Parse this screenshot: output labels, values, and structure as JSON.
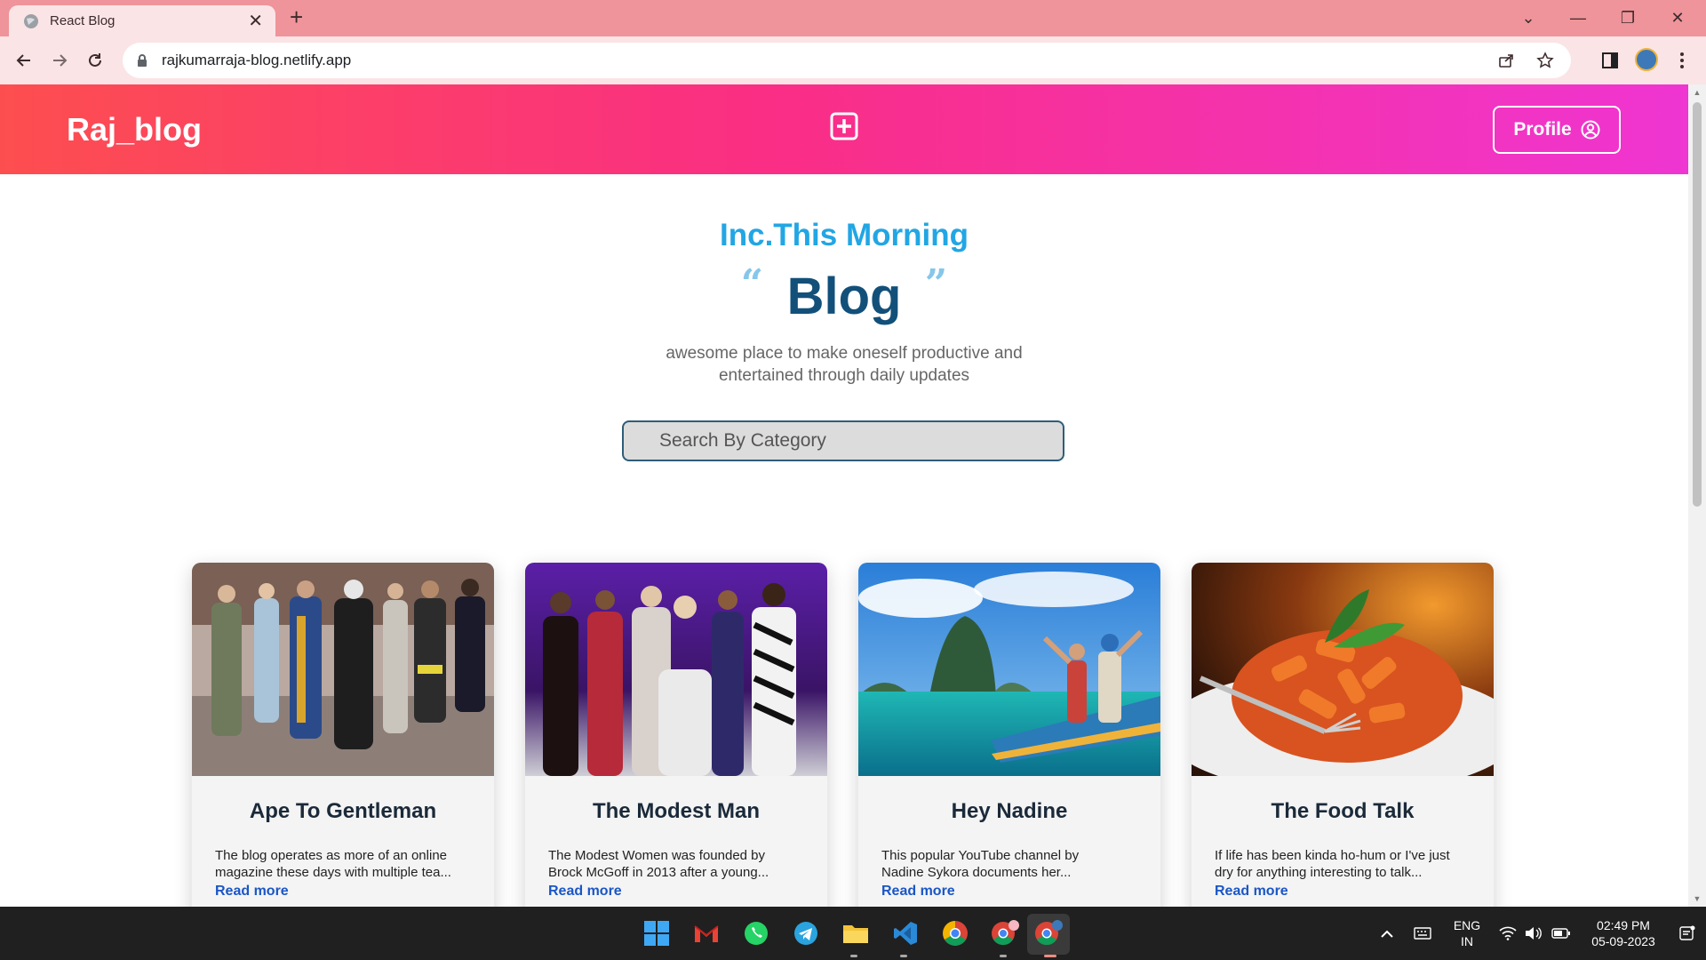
{
  "browser": {
    "tab_title": "React Blog",
    "tab_close": "✕",
    "new_tab": "+",
    "url": "rajkumarraja-blog.netlify.app",
    "window_controls": [
      "⌄",
      "—",
      "❐",
      "✕"
    ]
  },
  "site": {
    "brand": "Raj_blog",
    "profile_label": "Profile",
    "header_gradient": [
      "#fd4e4f",
      "#fa2e84",
      "#ef35d2"
    ]
  },
  "hero": {
    "subtitle": "Inc.This Morning",
    "open_quote": "“",
    "title": "Blog",
    "close_quote": "”",
    "tagline_line1": "awesome place to make oneself productive and",
    "tagline_line2": "entertained through daily updates"
  },
  "search": {
    "placeholder": "Search By Category"
  },
  "cards": [
    {
      "title": "Ape To Gentleman",
      "desc_line1": "The blog operates as more of an online",
      "desc_line2": "magazine these days with multiple tea...",
      "read_more": "Read more"
    },
    {
      "title": "The Modest Man",
      "desc_line1": "The Modest Women was founded by",
      "desc_line2": "Brock McGoff in 2013 after a young...",
      "read_more": "Read more"
    },
    {
      "title": "Hey Nadine",
      "desc_line1": "This popular YouTube channel by",
      "desc_line2": "Nadine Sykora documents her...",
      "read_more": "Read more"
    },
    {
      "title": "The Food Talk",
      "desc_line1": "If life has been kinda ho-hum or I've just",
      "desc_line2": "dry for anything interesting to talk...",
      "read_more": "Read more"
    }
  ],
  "taskbar": {
    "apps": [
      "windows-start",
      "gmail",
      "whatsapp",
      "telegram",
      "file-explorer",
      "vscode",
      "chrome",
      "chrome-profile",
      "chrome-active"
    ],
    "lang_line1": "ENG",
    "lang_line2": "IN",
    "time": "02:49 PM",
    "date": "05-09-2023"
  },
  "colors": {
    "accent_blue": "#22a6e4",
    "title_navy": "#12507a",
    "link_blue": "#1a56c6"
  }
}
